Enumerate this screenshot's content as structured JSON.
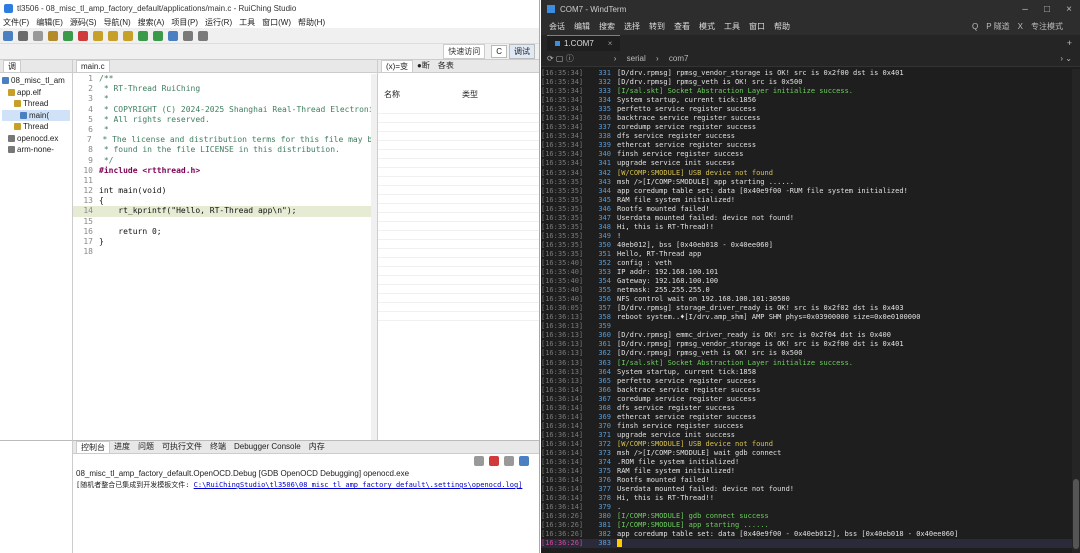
{
  "ide": {
    "title": "tl3506 - 08_misc_tl_amp_factory_default/applications/main.c - RuiChing Studio",
    "menu": [
      "文件(F)",
      "编辑(E)",
      "源码(S)",
      "导航(N)",
      "搜索(A)",
      "项目(P)",
      "运行(R)",
      "工具",
      "窗口(W)",
      "帮助(H)"
    ],
    "quick_access": "快速访问",
    "perspectives": [
      "C",
      "调试"
    ],
    "debug_tab": "调",
    "tree": [
      "08_misc_tl_am",
      "app.elf",
      "Thread",
      "main(",
      "Thread",
      "openocd.ex",
      "arm-none-"
    ],
    "editor_tab": "main.c",
    "vars_tabs": [
      "(x)=变",
      "●断",
      "各表"
    ],
    "vars_headers": [
      "名称",
      "类型"
    ],
    "code_lines": [
      {
        "n": "1",
        "t": "/**"
      },
      {
        "n": "2",
        "t": " * RT-Thread RuiChing"
      },
      {
        "n": "3",
        "t": " *"
      },
      {
        "n": "4",
        "t": " * COPYRIGHT (C) 2024-2025 Shanghai Real-Thread Electroni"
      },
      {
        "n": "5",
        "t": " * All rights reserved."
      },
      {
        "n": "6",
        "t": " *"
      },
      {
        "n": "7",
        "t": " * The license and distribution terms for this file may be"
      },
      {
        "n": "8",
        "t": " * found in the file LICENSE in this distribution."
      },
      {
        "n": "9",
        "t": " */"
      },
      {
        "n": "10",
        "t": "#include <rtthread.h>"
      },
      {
        "n": "11",
        "t": ""
      },
      {
        "n": "12",
        "t": "int main(void)"
      },
      {
        "n": "13",
        "t": "{"
      },
      {
        "n": "14",
        "t": "    rt_kprintf(\"Hello, RT-Thread app\\n\");"
      },
      {
        "n": "15",
        "t": ""
      },
      {
        "n": "16",
        "t": "    return 0;"
      },
      {
        "n": "17",
        "t": "}"
      },
      {
        "n": "18",
        "t": ""
      }
    ],
    "console_tabs": [
      "控制台",
      "进度",
      "问题",
      "可执行文件",
      "终端",
      "Debugger Console",
      "内存"
    ],
    "console_title": "08_misc_tl_amp_factory_default.OpenOCD.Debug [GDB OpenOCD Debugging] openocd.exe",
    "console_line_prefix": "[随机者整合已集成到开发模板文件: ",
    "console_line_link": "C:\\RuiChingStudio\\tl3506\\08_misc_tl_amp_factory_default\\.settings\\openocd.log]"
  },
  "wt": {
    "title": "COM7 - WindTerm",
    "menu": [
      "会话",
      "编辑",
      "搜索",
      "选择",
      "转到",
      "查看",
      "模式",
      "工具",
      "窗口",
      "帮助"
    ],
    "menu_right": [
      "Q",
      "P 隧道",
      "X",
      "专注模式"
    ],
    "tab": "1.COM7",
    "crumb": [
      "serial",
      "com7"
    ],
    "lines": [
      {
        "ts": "[16:35:34]",
        "no": "331",
        "tx": "[D/drv.rpmsg] rpmsg_vendor_storage is OK! src is 0x2f00 dst is 0x401",
        "c": ""
      },
      {
        "ts": "[16:35:34]",
        "no": "332",
        "tx": "[D/drv.rpmsg] rpmsg_veth is OK! src is 0x500",
        "c": ""
      },
      {
        "ts": "[16:35:34]",
        "no": "333",
        "tx": "[I/sal.skt] Socket Abstraction Layer initialize success.",
        "c": "g"
      },
      {
        "ts": "[16:35:34]",
        "no": "334",
        "tx": "System startup, current tick:1856",
        "c": ""
      },
      {
        "ts": "[16:35:34]",
        "no": "335",
        "tx": "perfetto service register success",
        "c": ""
      },
      {
        "ts": "[16:35:34]",
        "no": "336",
        "tx": "backtrace service register success",
        "c": ""
      },
      {
        "ts": "[16:35:34]",
        "no": "337",
        "tx": "coredump service register success",
        "c": ""
      },
      {
        "ts": "[16:35:34]",
        "no": "338",
        "tx": "dfs service register success",
        "c": ""
      },
      {
        "ts": "[16:35:34]",
        "no": "339",
        "tx": "ethercat service register success",
        "c": ""
      },
      {
        "ts": "[16:35:34]",
        "no": "340",
        "tx": "finsh service register success",
        "c": ""
      },
      {
        "ts": "[16:35:34]",
        "no": "341",
        "tx": "upgrade service init success",
        "c": ""
      },
      {
        "ts": "[16:35:34]",
        "no": "342",
        "tx": "[W/COMP:SMODULE] USB device not found",
        "c": "y"
      },
      {
        "ts": "[16:35:35]",
        "no": "343",
        "tx": "msh />[I/COMP:SMODULE] app starting ......",
        "c": ""
      },
      {
        "ts": "[16:35:35]",
        "no": "344",
        "tx": "app coredump table set: data [0x40e9f00 -RUM file system initialized!",
        "c": ""
      },
      {
        "ts": "[16:35:35]",
        "no": "345",
        "tx": "RAM file system initialized!",
        "c": ""
      },
      {
        "ts": "[16:35:35]",
        "no": "346",
        "tx": "Rootfs mounted failed!",
        "c": ""
      },
      {
        "ts": "[16:35:35]",
        "no": "347",
        "tx": "Userdata mounted failed: device not found!",
        "c": ""
      },
      {
        "ts": "[16:35:35]",
        "no": "348",
        "tx": "Hi, this is RT-Thread!!",
        "c": ""
      },
      {
        "ts": "[16:35:35]",
        "no": "349",
        "tx": "!",
        "c": ""
      },
      {
        "ts": "[16:35:35]",
        "no": "350",
        "tx": "40eb012], bss [0x40eb018 - 0x40ee060]",
        "c": ""
      },
      {
        "ts": "[16:35:35]",
        "no": "351",
        "tx": "Hello, RT-Thread app",
        "c": ""
      },
      {
        "ts": "[16:35:40]",
        "no": "352",
        "tx": "config : veth",
        "c": ""
      },
      {
        "ts": "[16:35:40]",
        "no": "353",
        "tx": "IP addr: 192.168.100.101",
        "c": ""
      },
      {
        "ts": "[16:35:40]",
        "no": "354",
        "tx": "Gateway: 192.168.100.100",
        "c": ""
      },
      {
        "ts": "[16:35:40]",
        "no": "355",
        "tx": "netmask: 255.255.255.0",
        "c": ""
      },
      {
        "ts": "[16:35:40]",
        "no": "356",
        "tx": "NFS control wait on 192.168.100.101:30500",
        "c": ""
      },
      {
        "ts": "[16:36:05]",
        "no": "357",
        "tx": "[D/drv.rpmsg] storage_driver_ready is OK! src is 0x2f02 dst is 0x403",
        "c": ""
      },
      {
        "ts": "[16:36:13]",
        "no": "358",
        "tx": "reboot system..♦[I/drv.amp_shm] AMP SHM phys=0x03900000 size=0x0e0100000",
        "c": ""
      },
      {
        "ts": "[16:36:13]",
        "no": "359",
        "tx": "",
        "c": ""
      },
      {
        "ts": "[16:36:13]",
        "no": "360",
        "tx": "[D/drv.rpmsg] emmc_driver_ready is OK! src is 0x2f04 dst is 0x400",
        "c": ""
      },
      {
        "ts": "[16:36:13]",
        "no": "361",
        "tx": "[D/drv.rpmsg] rpmsg_vendor_storage is OK! src is 0x2f00 dst is 0x401",
        "c": ""
      },
      {
        "ts": "[16:36:13]",
        "no": "362",
        "tx": "[D/drv.rpmsg] rpmsg_veth is OK! src is 0x500",
        "c": ""
      },
      {
        "ts": "[16:36:13]",
        "no": "363",
        "tx": "[I/sal.skt] Socket Abstraction Layer initialize success.",
        "c": "g"
      },
      {
        "ts": "[16:36:13]",
        "no": "364",
        "tx": "System startup, current tick:1858",
        "c": ""
      },
      {
        "ts": "[16:36:13]",
        "no": "365",
        "tx": "perfetto service register success",
        "c": ""
      },
      {
        "ts": "[16:36:14]",
        "no": "366",
        "tx": "backtrace service register success",
        "c": ""
      },
      {
        "ts": "[16:36:14]",
        "no": "367",
        "tx": "coredump service register success",
        "c": ""
      },
      {
        "ts": "[16:36:14]",
        "no": "368",
        "tx": "dfs service register success",
        "c": ""
      },
      {
        "ts": "[16:36:14]",
        "no": "369",
        "tx": "ethercat service register success",
        "c": ""
      },
      {
        "ts": "[16:36:14]",
        "no": "370",
        "tx": "finsh service register success",
        "c": ""
      },
      {
        "ts": "[16:36:14]",
        "no": "371",
        "tx": "upgrade service init success",
        "c": ""
      },
      {
        "ts": "[16:36:14]",
        "no": "372",
        "tx": "[W/COMP:SMODULE] USB device not found",
        "c": "y"
      },
      {
        "ts": "[16:36:14]",
        "no": "373",
        "tx": "msh />[I/COMP:SMODULE] wait gdb connect",
        "c": ""
      },
      {
        "ts": "[16:36:14]",
        "no": "374",
        "tx": ".ROM file system initialized!",
        "c": ""
      },
      {
        "ts": "[16:36:14]",
        "no": "375",
        "tx": "RAM file system initialized!",
        "c": ""
      },
      {
        "ts": "[16:36:14]",
        "no": "376",
        "tx": "Rootfs mounted failed!",
        "c": ""
      },
      {
        "ts": "[16:36:14]",
        "no": "377",
        "tx": "Userdata mounted failed: device not found!",
        "c": ""
      },
      {
        "ts": "[16:36:14]",
        "no": "378",
        "tx": "Hi, this is RT-Thread!!",
        "c": ""
      },
      {
        "ts": "[16:36:14]",
        "no": "379",
        "tx": ".",
        "c": ""
      },
      {
        "ts": "[16:36:26]",
        "no": "380",
        "tx": "[I/COMP:SMODULE] gdb connect success",
        "c": "g"
      },
      {
        "ts": "[16:36:26]",
        "no": "381",
        "tx": "[I/COMP:SMODULE] app starting ......",
        "c": "g"
      },
      {
        "ts": "[16:36:26]",
        "no": "382",
        "tx": "app coredump table set: data [0x40e9f00 - 0x40eb012], bss [0x40eb018 - 0x40ee060]",
        "c": ""
      },
      {
        "ts": "[16:36:26]",
        "no": "383",
        "tx": "",
        "c": ""
      }
    ]
  }
}
